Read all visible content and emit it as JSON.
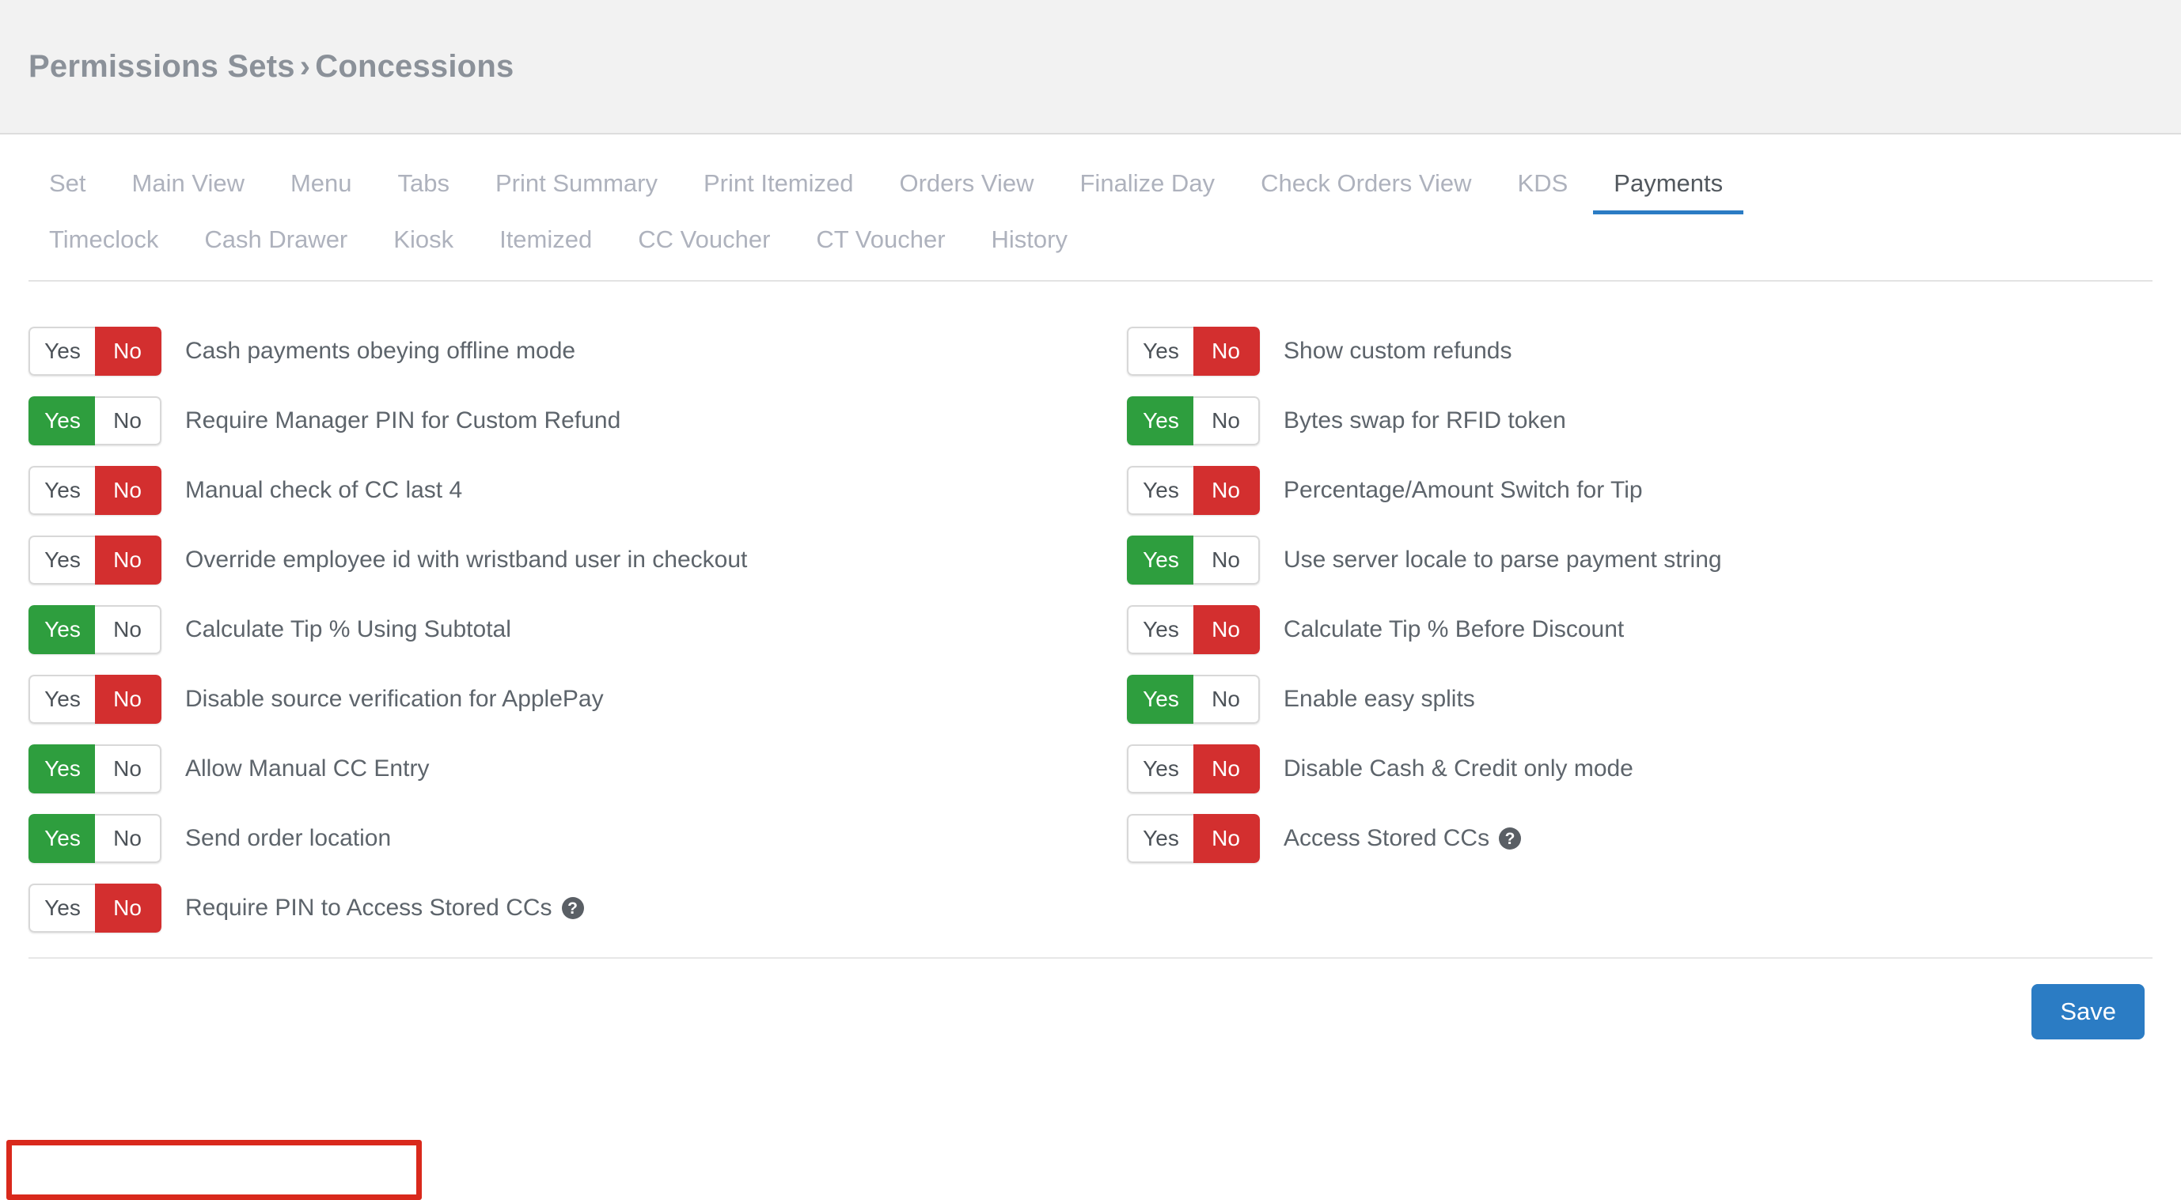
{
  "header": {
    "breadcrumb_parent": "Permissions Sets",
    "breadcrumb_separator": "›",
    "breadcrumb_current": "Concessions"
  },
  "tabs": {
    "row1": [
      {
        "label": "Set",
        "active": false
      },
      {
        "label": "Main View",
        "active": false
      },
      {
        "label": "Menu",
        "active": false
      },
      {
        "label": "Tabs",
        "active": false
      },
      {
        "label": "Print Summary",
        "active": false
      },
      {
        "label": "Print Itemized",
        "active": false
      },
      {
        "label": "Orders View",
        "active": false
      },
      {
        "label": "Finalize Day",
        "active": false
      },
      {
        "label": "Check Orders View",
        "active": false
      },
      {
        "label": "KDS",
        "active": false
      },
      {
        "label": "Payments",
        "active": true
      }
    ],
    "row2": [
      {
        "label": "Timeclock",
        "active": false
      },
      {
        "label": "Cash Drawer",
        "active": false
      },
      {
        "label": "Kiosk",
        "active": false
      },
      {
        "label": "Itemized",
        "active": false
      },
      {
        "label": "CC Voucher",
        "active": false
      },
      {
        "label": "CT Voucher",
        "active": false
      },
      {
        "label": "History",
        "active": false
      }
    ]
  },
  "toggle": {
    "yes_label": "Yes",
    "no_label": "No",
    "help_glyph": "?"
  },
  "settings": {
    "left_column": [
      {
        "label": "Cash payments obeying offline mode",
        "value": "No",
        "help": false,
        "highlighted": false
      },
      {
        "label": "Require Manager PIN for Custom Refund",
        "value": "Yes",
        "help": false,
        "highlighted": false
      },
      {
        "label": "Manual check of CC last 4",
        "value": "No",
        "help": false,
        "highlighted": false
      },
      {
        "label": "Override employee id with wristband user in checkout",
        "value": "No",
        "help": false,
        "highlighted": false
      },
      {
        "label": "Calculate Tip % Using Subtotal",
        "value": "Yes",
        "help": false,
        "highlighted": false
      },
      {
        "label": "Disable source verification for ApplePay",
        "value": "No",
        "help": false,
        "highlighted": false
      },
      {
        "label": "Allow Manual CC Entry",
        "value": "Yes",
        "help": false,
        "highlighted": false
      },
      {
        "label": "Send order location",
        "value": "Yes",
        "help": false,
        "highlighted": true
      },
      {
        "label": "Require PIN to Access Stored CCs",
        "value": "No",
        "help": true,
        "highlighted": false
      }
    ],
    "right_column": [
      {
        "label": "Show custom refunds",
        "value": "No",
        "help": false,
        "highlighted": false
      },
      {
        "label": "Bytes swap for RFID token",
        "value": "Yes",
        "help": false,
        "highlighted": false
      },
      {
        "label": "Percentage/Amount Switch for Tip",
        "value": "No",
        "help": false,
        "highlighted": false
      },
      {
        "label": "Use server locale to parse payment string",
        "value": "Yes",
        "help": false,
        "highlighted": false
      },
      {
        "label": "Calculate Tip % Before Discount",
        "value": "No",
        "help": false,
        "highlighted": false
      },
      {
        "label": "Enable easy splits",
        "value": "Yes",
        "help": false,
        "highlighted": false
      },
      {
        "label": "Disable Cash & Credit only mode",
        "value": "No",
        "help": false,
        "highlighted": false
      },
      {
        "label": "Access Stored CCs",
        "value": "No",
        "help": true,
        "highlighted": false
      }
    ]
  },
  "footer": {
    "save_label": "Save"
  },
  "colors": {
    "accent_blue": "#2b7cc4",
    "toggle_green": "#2e9e3e",
    "toggle_red": "#d32f2f",
    "highlight_red": "#d9291c",
    "header_bg": "#f2f2f2"
  }
}
